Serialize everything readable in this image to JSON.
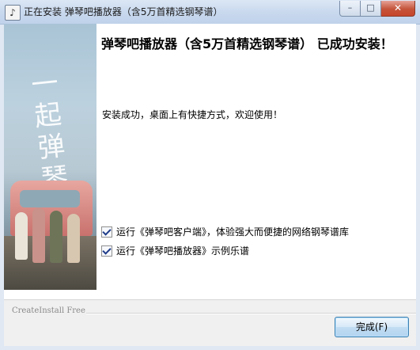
{
  "window": {
    "title": "正在安装 弹琴吧播放器（含5万首精选钢琴谱）",
    "icon": "installer-app-icon",
    "buttons": {
      "minimize": "–",
      "maximize": "□",
      "close": "✕"
    }
  },
  "banner": {
    "calligraphy": "一起弹琴吧"
  },
  "main": {
    "heading": "弹琴吧播放器（含5万首精选钢琴谱） 已成功安装！",
    "message": "安装成功，桌面上有快捷方式，欢迎使用！",
    "options": [
      {
        "label": "运行《弹琴吧客户端》，体验强大而便捷的网络钢琴谱库",
        "checked": true
      },
      {
        "label": "运行《弹琴吧播放器》示例乐谱",
        "checked": true
      }
    ]
  },
  "footer": {
    "brand": "CreateInstall Free",
    "finish_label": "完成(F)"
  }
}
